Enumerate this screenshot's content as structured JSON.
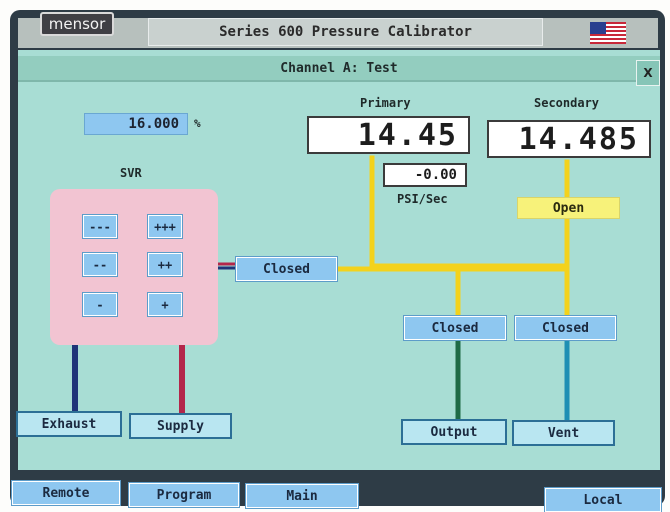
{
  "header": {
    "logo_text": "mensor",
    "app_title": "Series 600 Pressure Calibrator"
  },
  "channel": {
    "title": "Channel A: Test",
    "close_label": "X"
  },
  "percent": {
    "value": "16.000",
    "unit": "%"
  },
  "svr": {
    "label": "SVR",
    "buttons": [
      "---",
      "+++",
      "--",
      "++",
      "-",
      "+"
    ]
  },
  "primary": {
    "label": "Primary",
    "value": "14.45",
    "rate": "-0.00",
    "rate_unit": "PSI/Sec"
  },
  "secondary": {
    "label": "Secondary",
    "value": "14.485",
    "valve_state": "Open"
  },
  "valves": {
    "svr_valve": "Closed",
    "output_valve": "Closed",
    "vent_valve": "Closed"
  },
  "ports": {
    "exhaust": "Exhaust",
    "supply": "Supply",
    "output": "Output",
    "vent": "Vent"
  },
  "nav": {
    "remote": "Remote",
    "program": "Program",
    "main": "Main",
    "local": "Local"
  },
  "colors": {
    "panel": "#a8ddd4",
    "button": "#8ec7f0",
    "pipe_yellow": "#f3d21c",
    "pipe_green": "#1f6a46",
    "pipe_blue": "#1f8fb4",
    "pipe_navy": "#1f3478",
    "pipe_red": "#b3264a",
    "svr_pink": "#f2c4d2"
  }
}
